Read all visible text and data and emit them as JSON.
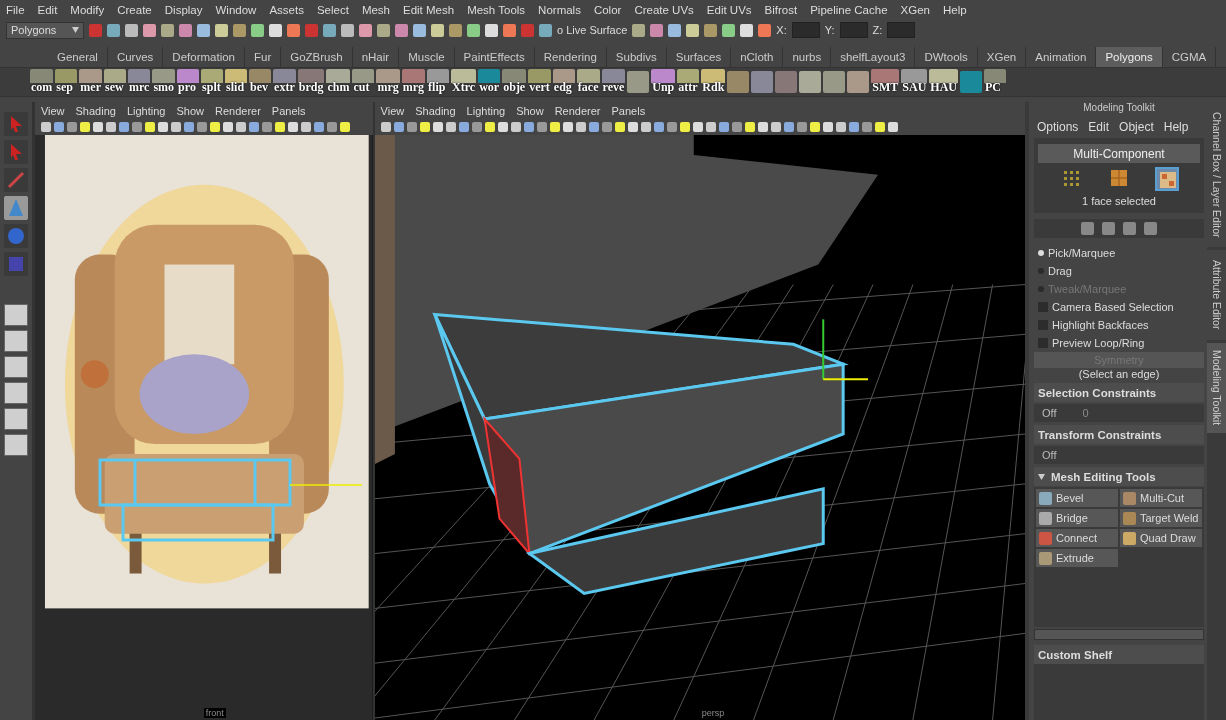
{
  "menu_bar": [
    "File",
    "Edit",
    "Modify",
    "Create",
    "Display",
    "Window",
    "Assets",
    "Select",
    "Mesh",
    "Edit Mesh",
    "Mesh Tools",
    "Normals",
    "Color",
    "Create UVs",
    "Edit UVs",
    "Bifrost",
    "Pipeline Cache",
    "XGen",
    "Help"
  ],
  "status_line": {
    "mode": "Polygons",
    "live_surface": "o Live Surface",
    "coord_labels": [
      "X:",
      "Y:",
      "Z:"
    ]
  },
  "shelf_tabs": [
    {
      "label": "General",
      "selected": false
    },
    {
      "label": "Curves",
      "selected": false
    },
    {
      "label": "Deformation",
      "selected": false
    },
    {
      "label": "Fur",
      "selected": false
    },
    {
      "label": "GoZBrush",
      "selected": false
    },
    {
      "label": "nHair",
      "selected": false
    },
    {
      "label": "Muscle",
      "selected": false
    },
    {
      "label": "PaintEffects",
      "selected": false
    },
    {
      "label": "Rendering",
      "selected": false
    },
    {
      "label": "Subdivs",
      "selected": false
    },
    {
      "label": "Surfaces",
      "selected": false
    },
    {
      "label": "nCloth",
      "selected": false
    },
    {
      "label": "nurbs",
      "selected": false
    },
    {
      "label": "shelfLayout3",
      "selected": false
    },
    {
      "label": "DWtools",
      "selected": false
    },
    {
      "label": "XGen",
      "selected": false
    },
    {
      "label": "Animation",
      "selected": false
    },
    {
      "label": "Polygons",
      "selected": true
    },
    {
      "label": "CGMA",
      "selected": false
    }
  ],
  "shelf_items": [
    {
      "label": "com"
    },
    {
      "label": "sep"
    },
    {
      "label": "mer"
    },
    {
      "label": "sew"
    },
    {
      "label": "mrc"
    },
    {
      "label": "smo"
    },
    {
      "label": "pro"
    },
    {
      "label": "splt"
    },
    {
      "label": "slid"
    },
    {
      "label": "bev"
    },
    {
      "label": "extr"
    },
    {
      "label": "brdg"
    },
    {
      "label": "chm"
    },
    {
      "label": "cut"
    },
    {
      "label": "mrg"
    },
    {
      "label": "mrg"
    },
    {
      "label": "flip"
    },
    {
      "label": "Xtrc"
    },
    {
      "label": "wor"
    },
    {
      "label": "obje"
    },
    {
      "label": "vert"
    },
    {
      "label": "edg"
    },
    {
      "label": "face"
    },
    {
      "label": "reve"
    },
    {
      "kind": "icon"
    },
    {
      "label": "Unp"
    },
    {
      "label": "attr"
    },
    {
      "label": "Rdk"
    },
    {
      "kind": "icon"
    },
    {
      "kind": "icon"
    },
    {
      "kind": "icon"
    },
    {
      "kind": "icon"
    },
    {
      "kind": "icon"
    },
    {
      "kind": "icon"
    },
    {
      "label": "SMT"
    },
    {
      "label": "SAU"
    },
    {
      "label": "HAU"
    },
    {
      "kind": "icon"
    },
    {
      "label": "PC"
    }
  ],
  "tools": [
    {
      "kind": "select",
      "selected": false
    },
    {
      "kind": "lasso",
      "selected": false
    },
    {
      "kind": "paint",
      "selected": false
    },
    {
      "kind": "move",
      "selected": true
    },
    {
      "kind": "rotate",
      "selected": false
    },
    {
      "kind": "scale",
      "selected": false
    }
  ],
  "viewports": [
    {
      "menus": [
        "View",
        "Shading",
        "Lighting",
        "Show",
        "Renderer",
        "Panels"
      ],
      "camera": "front"
    },
    {
      "menus": [
        "View",
        "Shading",
        "Lighting",
        "Show",
        "Renderer",
        "Panels"
      ],
      "camera": "persp"
    }
  ],
  "modeling_toolkit": {
    "title": "Modeling Toolkit",
    "menus": [
      "Options",
      "Edit",
      "Object",
      "Help"
    ],
    "mode_button": "Multi-Component",
    "components": [
      {
        "kind": "vertex",
        "selected": false
      },
      {
        "kind": "edge",
        "selected": false
      },
      {
        "kind": "face",
        "selected": true
      }
    ],
    "selection_status": "1 face selected",
    "pick_modes": [
      {
        "label": "Pick/Marquee",
        "selected": true,
        "disabled": false
      },
      {
        "label": "Drag",
        "selected": false,
        "disabled": false
      },
      {
        "label": "Tweak/Marquee",
        "selected": false,
        "disabled": true
      }
    ],
    "options": [
      {
        "label": "Camera Based Selection",
        "checked": false
      },
      {
        "label": "Highlight Backfaces",
        "checked": false
      },
      {
        "label": "Preview Loop/Ring",
        "checked": false
      }
    ],
    "symmetry": {
      "label": "Symmetry",
      "disabled": true
    },
    "symmetry_hint": "(Select an edge)",
    "constraints": [
      {
        "title": "Selection Constraints",
        "value": "Off",
        "value_2": "0"
      },
      {
        "title": "Transform Constraints",
        "value": "Off"
      }
    ],
    "mesh_tools": {
      "title": "Mesh Editing Tools",
      "expanded": true,
      "tools": [
        "Bevel",
        "Multi-Cut",
        "Bridge",
        "Target Weld",
        "Connect",
        "Quad Draw",
        "Extrude"
      ]
    },
    "custom_shelf": "Custom Shelf"
  },
  "side_tabs": [
    {
      "label": "Channel Box / Layer Editor",
      "selected": false
    },
    {
      "label": "Attribute Editor",
      "selected": false
    },
    {
      "label": "Modeling Toolkit",
      "selected": true
    }
  ]
}
